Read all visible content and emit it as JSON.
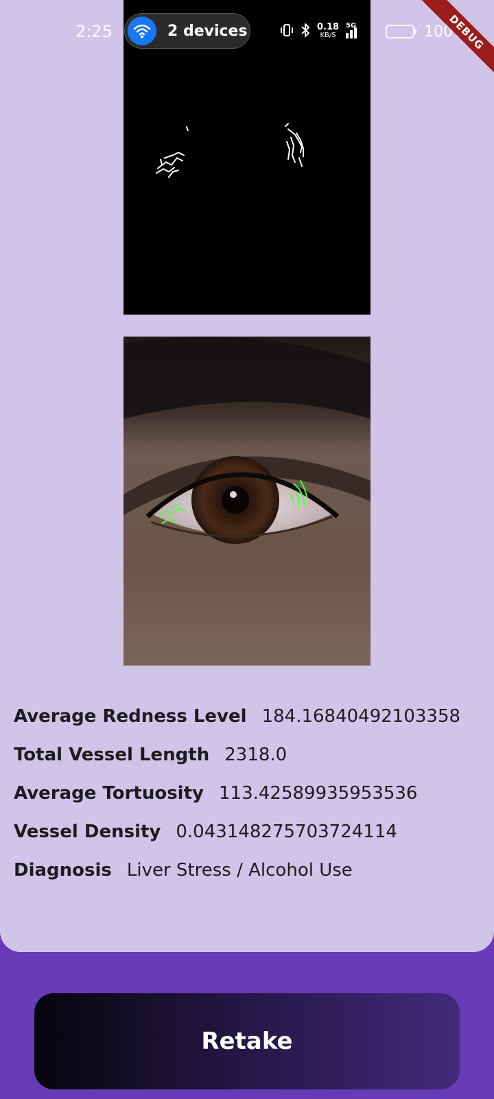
{
  "status_bar": {
    "time": "2:25",
    "connection_pill": "2 devices",
    "net_speed_value": "0.18",
    "net_speed_unit": "KB/S",
    "network": "5G",
    "battery": "100%"
  },
  "debug_banner": "DEBUG",
  "images": {
    "mask_icon": "vessel-mask-image",
    "eye_icon": "eye-photo-with-overlay"
  },
  "metrics": [
    {
      "label": "Average Redness Level",
      "value": "184.16840492103358"
    },
    {
      "label": "Total Vessel Length",
      "value": "2318.0"
    },
    {
      "label": "Average Tortuosity",
      "value": "113.42589935953536"
    },
    {
      "label": "Vessel Density",
      "value": "0.043148275703724114"
    },
    {
      "label": "Diagnosis",
      "value": "Liver Stress / Alcohol Use"
    }
  ],
  "actions": {
    "retake_label": "Retake"
  },
  "colors": {
    "sheet_bg": "#d1c4e9",
    "page_bg": "#673ab7",
    "overlay_green": "#4cff3a"
  }
}
